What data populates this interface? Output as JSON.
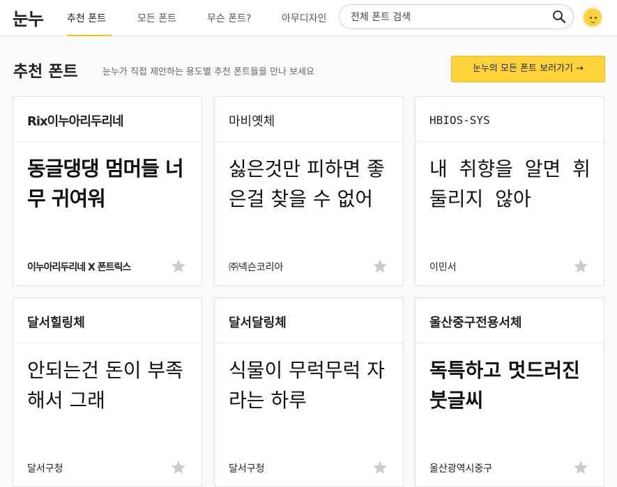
{
  "header": {
    "logo": "눈누",
    "nav": [
      "추천 폰트",
      "모든 폰트",
      "무슨 폰트?",
      "아무디자인"
    ],
    "search_placeholder": "전체 폰트 검색"
  },
  "main": {
    "title": "추천 폰트",
    "description": "눈누가 직접 제안하는 용도별 추천 폰트들을 만나 보세요",
    "cta": "눈누의 모든 폰트 보러가기 →"
  },
  "cards": [
    {
      "name": "Rix이누아리두리네",
      "sample": "동글댕댕 멈머들 너무 귀여워",
      "maker": "이누아리두리네 X 폰트릭스"
    },
    {
      "name": "마비옛체",
      "sample": "싫은것만 피하면 좋은걸 찾을 수 없어",
      "maker": "㈜넥슨코리아"
    },
    {
      "name": "HBIOS-SYS",
      "sample": "내 취향을 알면 휘둘리지 않아",
      "maker": "이민서"
    },
    {
      "name": "달서힐링체",
      "sample": "안되는건 돈이 부족해서 그래",
      "maker": "달서구청"
    },
    {
      "name": "달서달링체",
      "sample": "식물이 무럭무럭 자라는 하루",
      "maker": "달서구청"
    },
    {
      "name": "울산중구전용서체",
      "sample": "독특하고 멋드러진 붓글씨",
      "maker": "울산광역시중구"
    }
  ],
  "colors": {
    "accent": "#ffd43b",
    "star": "#cccccc"
  }
}
